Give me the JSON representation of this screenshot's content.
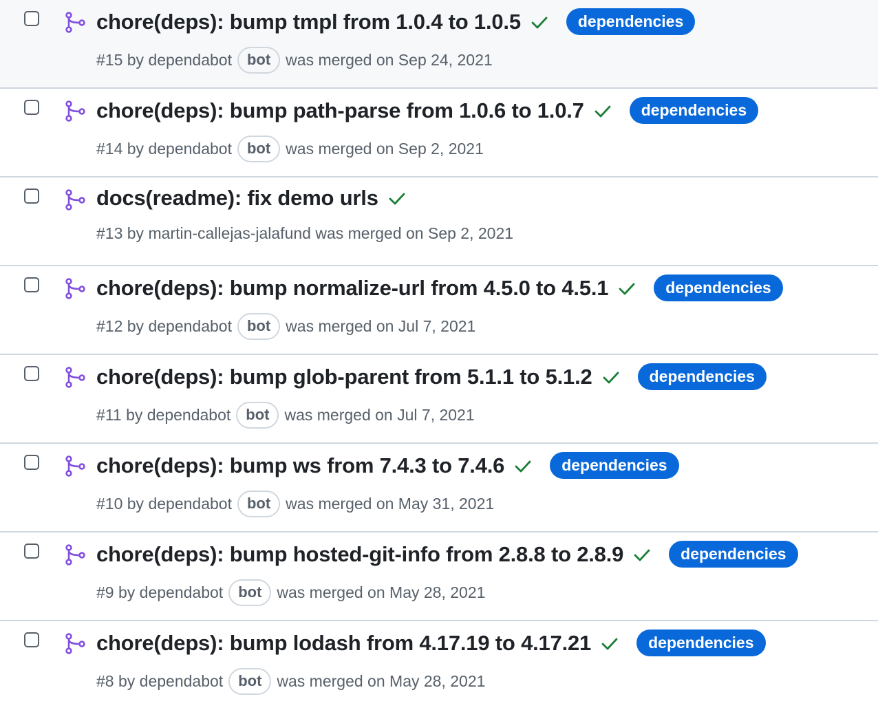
{
  "colors": {
    "merged_purple": "#8250df",
    "check_green": "#1a7f37",
    "label_blue": "#0969da",
    "muted_text": "#57606a",
    "border": "#d0d7de"
  },
  "icons": {
    "merged": "git-merge-icon",
    "status": "check-icon"
  },
  "pull_requests": [
    {
      "title": "chore(deps): bump tmpl from 1.0.4 to 1.0.5",
      "number": "#15",
      "by": "by",
      "author": "dependabot",
      "bot_badge": "bot",
      "merged_text": "was merged on Sep 24, 2021",
      "label": "dependencies"
    },
    {
      "title": "chore(deps): bump path-parse from 1.0.6 to 1.0.7",
      "number": "#14",
      "by": "by",
      "author": "dependabot",
      "bot_badge": "bot",
      "merged_text": "was merged on Sep 2, 2021",
      "label": "dependencies"
    },
    {
      "title": "docs(readme): fix demo urls",
      "number": "#13",
      "by": "by",
      "author": "martin-callejas-jalafund",
      "bot_badge": null,
      "merged_text": "was merged on Sep 2, 2021",
      "label": null
    },
    {
      "title": "chore(deps): bump normalize-url from 4.5.0 to 4.5.1",
      "number": "#12",
      "by": "by",
      "author": "dependabot",
      "bot_badge": "bot",
      "merged_text": "was merged on Jul 7, 2021",
      "label": "dependencies"
    },
    {
      "title": "chore(deps): bump glob-parent from 5.1.1 to 5.1.2",
      "number": "#11",
      "by": "by",
      "author": "dependabot",
      "bot_badge": "bot",
      "merged_text": "was merged on Jul 7, 2021",
      "label": "dependencies"
    },
    {
      "title": "chore(deps): bump ws from 7.4.3 to 7.4.6",
      "number": "#10",
      "by": "by",
      "author": "dependabot",
      "bot_badge": "bot",
      "merged_text": "was merged on May 31, 2021",
      "label": "dependencies"
    },
    {
      "title": "chore(deps): bump hosted-git-info from 2.8.8 to 2.8.9",
      "number": "#9",
      "by": "by",
      "author": "dependabot",
      "bot_badge": "bot",
      "merged_text": "was merged on May 28, 2021",
      "label": "dependencies"
    },
    {
      "title": "chore(deps): bump lodash from 4.17.19 to 4.17.21",
      "number": "#8",
      "by": "by",
      "author": "dependabot",
      "bot_badge": "bot",
      "merged_text": "was merged on May 28, 2021",
      "label": "dependencies"
    }
  ]
}
